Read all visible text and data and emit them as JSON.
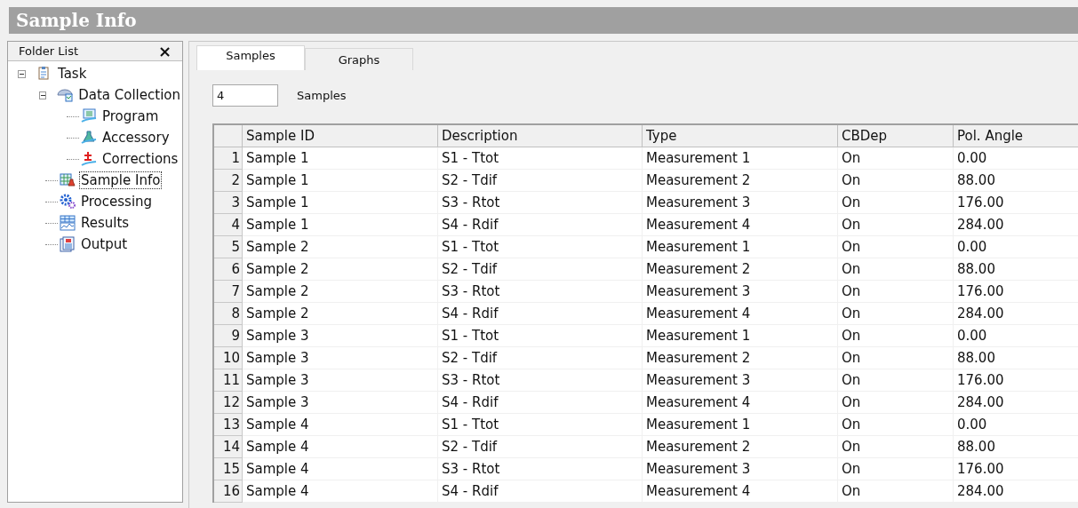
{
  "window": {
    "title": "Sample Info"
  },
  "folder_list": {
    "title": "Folder List",
    "close": "×",
    "items": [
      {
        "label": "Task",
        "expanded": true,
        "selected": false,
        "children": [
          {
            "label": "Data Collection",
            "expanded": true,
            "selected": false,
            "children": [
              {
                "label": "Program",
                "selected": false
              },
              {
                "label": "Accessory",
                "selected": false
              },
              {
                "label": "Corrections",
                "selected": false
              }
            ]
          },
          {
            "label": "Sample Info",
            "selected": true
          },
          {
            "label": "Processing",
            "selected": false
          },
          {
            "label": "Results",
            "selected": false
          },
          {
            "label": "Output",
            "selected": false
          }
        ]
      }
    ]
  },
  "tabs": [
    {
      "label": "Samples",
      "selected": true
    },
    {
      "label": "Graphs",
      "selected": false
    }
  ],
  "samples_count": {
    "value": "4",
    "label": "Samples"
  },
  "table": {
    "columns": [
      "Sample ID",
      "Description",
      "Type",
      "CBDep",
      "Pol. Angle"
    ],
    "rows": [
      {
        "num": "1",
        "cells": [
          "Sample 1",
          "S1 - Ttot",
          "Measurement 1",
          "On",
          "0.00"
        ]
      },
      {
        "num": "2",
        "cells": [
          "Sample 1",
          "S2 - Tdif",
          "Measurement 2",
          "On",
          "88.00"
        ]
      },
      {
        "num": "3",
        "cells": [
          "Sample 1",
          "S3 - Rtot",
          "Measurement 3",
          "On",
          "176.00"
        ]
      },
      {
        "num": "4",
        "cells": [
          "Sample 1",
          "S4 - Rdif",
          "Measurement 4",
          "On",
          "284.00"
        ]
      },
      {
        "num": "5",
        "cells": [
          "Sample 2",
          "S1 - Ttot",
          "Measurement 1",
          "On",
          "0.00"
        ]
      },
      {
        "num": "6",
        "cells": [
          "Sample 2",
          "S2 - Tdif",
          "Measurement 2",
          "On",
          "88.00"
        ]
      },
      {
        "num": "7",
        "cells": [
          "Sample 2",
          "S3 - Rtot",
          "Measurement 3",
          "On",
          "176.00"
        ]
      },
      {
        "num": "8",
        "cells": [
          "Sample 2",
          "S4 - Rdif",
          "Measurement 4",
          "On",
          "284.00"
        ]
      },
      {
        "num": "9",
        "cells": [
          "Sample 3",
          "S1 - Ttot",
          "Measurement 1",
          "On",
          "0.00"
        ]
      },
      {
        "num": "10",
        "cells": [
          "Sample 3",
          "S2 - Tdif",
          "Measurement 2",
          "On",
          "88.00"
        ]
      },
      {
        "num": "11",
        "cells": [
          "Sample 3",
          "S3 - Rtot",
          "Measurement 3",
          "On",
          "176.00"
        ]
      },
      {
        "num": "12",
        "cells": [
          "Sample 3",
          "S4 - Rdif",
          "Measurement 4",
          "On",
          "284.00"
        ]
      },
      {
        "num": "13",
        "cells": [
          "Sample 4",
          "S1 - Ttot",
          "Measurement 1",
          "On",
          "0.00"
        ]
      },
      {
        "num": "14",
        "cells": [
          "Sample 4",
          "S2 - Tdif",
          "Measurement 2",
          "On",
          "88.00"
        ]
      },
      {
        "num": "15",
        "cells": [
          "Sample 4",
          "S3 - Rtot",
          "Measurement 3",
          "On",
          "176.00"
        ]
      },
      {
        "num": "16",
        "cells": [
          "Sample 4",
          "S4 - Rdif",
          "Measurement 4",
          "On",
          "284.00"
        ]
      }
    ]
  }
}
